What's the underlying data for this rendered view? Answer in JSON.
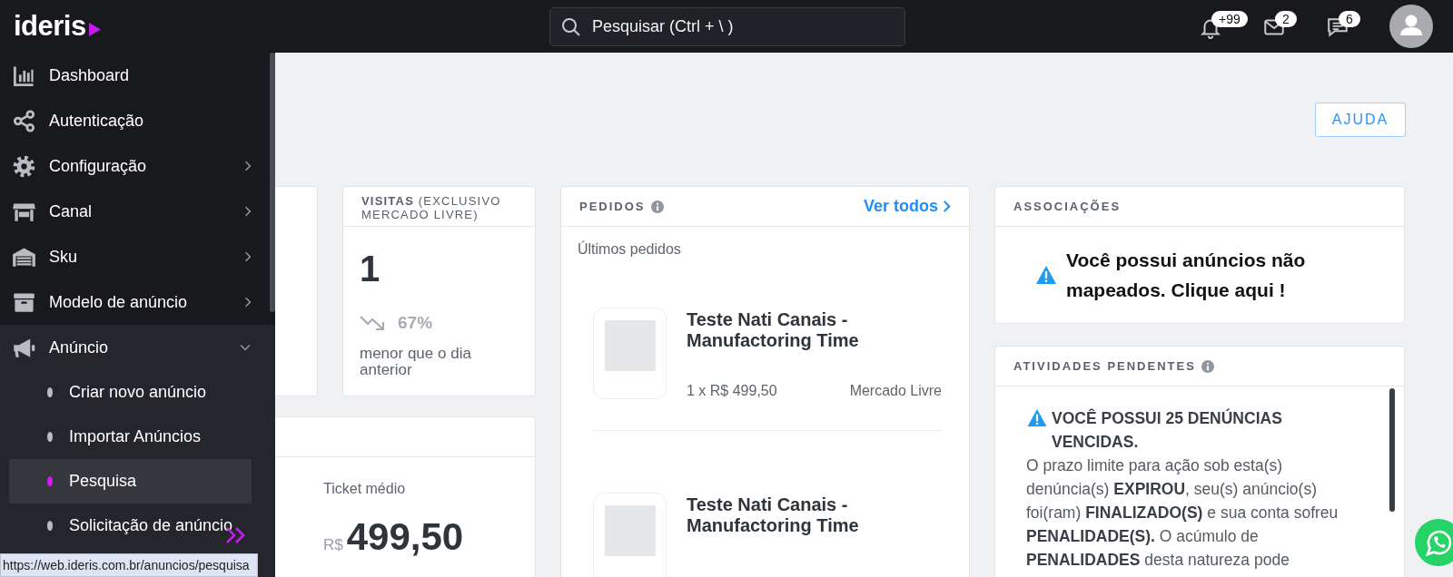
{
  "header": {
    "logo": "ideris",
    "search": {
      "placeholder": "Pesquisar (Ctrl + \\ )"
    },
    "notifications": [
      {
        "kind": "bell",
        "count": "+99"
      },
      {
        "kind": "mail",
        "count": "2"
      },
      {
        "kind": "chat",
        "count": "6"
      }
    ]
  },
  "sidebar": {
    "items": [
      {
        "label": "Dashboard"
      },
      {
        "label": "Autenticação"
      },
      {
        "label": "Configuração",
        "expanded": false
      },
      {
        "label": "Canal",
        "expanded": false
      },
      {
        "label": "Sku",
        "expanded": false
      },
      {
        "label": "Modelo de anúncio",
        "expanded": false
      },
      {
        "label": "Anúncio",
        "expanded": true,
        "children": [
          {
            "label": "Criar novo anúncio",
            "selected": false
          },
          {
            "label": "Importar Anúncios",
            "selected": false
          },
          {
            "label": "Pesquisa",
            "selected": true
          },
          {
            "label": "Solicitação de anúncio",
            "selected": false
          }
        ]
      }
    ],
    "status_url": "https://web.ideris.com.br/anuncios/pesquisa"
  },
  "help_button": "AJUDA",
  "visits_card": {
    "title": "**VISITAS** (EXCLUSIVO MERCADO LIVRE)",
    "value": "1",
    "change": "67%",
    "comparison": "menor que o dia anterior"
  },
  "sales_card": {
    "label": "Ticket médio",
    "currency": "R$",
    "value": "499,50"
  },
  "orders_card": {
    "title": "PEDIDOS",
    "link": "Ver todos",
    "subtitle": "Últimos pedidos",
    "orders": [
      {
        "title": "Teste Nati Canais - Manufactoring Time",
        "quantity_price": "1 x R$ 499,50",
        "channel": "Mercado Livre"
      },
      {
        "title": "Teste Nati Canais - Manufactoring Time"
      }
    ]
  },
  "associations_card": {
    "title": "ASSOCIAÇÕES",
    "message": "Você possui anúncios não mapeados. Clique aqui !"
  },
  "pending_card": {
    "title": "ATIVIDADES PENDENTES",
    "heading": "VOCÊ POSSUI 25 DENÚNCIAS VENCIDAS.",
    "body": "O prazo limite para ação sob esta(s) denúncia(s) **EXPIROU**, seu(s) anúncio(s) foi(ram) **FINALIZADO(S)** e sua conta sofreu **PENALIDADE(S).** O acúmulo de **PENALIDADES** desta natureza pode"
  }
}
